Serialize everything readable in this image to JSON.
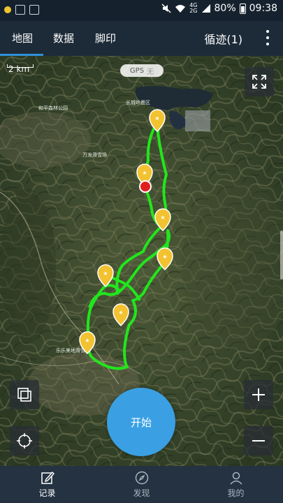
{
  "status_bar": {
    "network_small_top": "4G",
    "network_small_bottom": "2G",
    "battery": "80%",
    "time": "09:38"
  },
  "header": {
    "tabs": [
      {
        "label": "地图",
        "active": true
      },
      {
        "label": "数据",
        "active": false
      },
      {
        "label": "脚印",
        "active": false
      }
    ],
    "trail_button": "循迹(1)",
    "more_icon": "more-vertical-icon"
  },
  "map": {
    "scale_label": "2 km",
    "gps_label": "GPS",
    "gps_status": "无",
    "place_labels": [
      "长城岭景区",
      "和平森林公园",
      "万龙滑雪场",
      "乐乐美地滑雪场"
    ],
    "track_color": "#22e61c",
    "marker_color": "#f2c230",
    "current_position_color": "#e0201c"
  },
  "controls": {
    "fullscreen_icon": "expand-icon",
    "layers_icon": "layers-icon",
    "locate_icon": "locate-icon",
    "zoom_in_icon": "plus-icon",
    "zoom_out_icon": "minus-icon",
    "start_label": "开始"
  },
  "bottom_nav": [
    {
      "label": "记录",
      "icon": "edit-icon",
      "active": true
    },
    {
      "label": "发现",
      "icon": "compass-icon",
      "active": false
    },
    {
      "label": "我的",
      "icon": "user-icon",
      "active": false
    }
  ]
}
